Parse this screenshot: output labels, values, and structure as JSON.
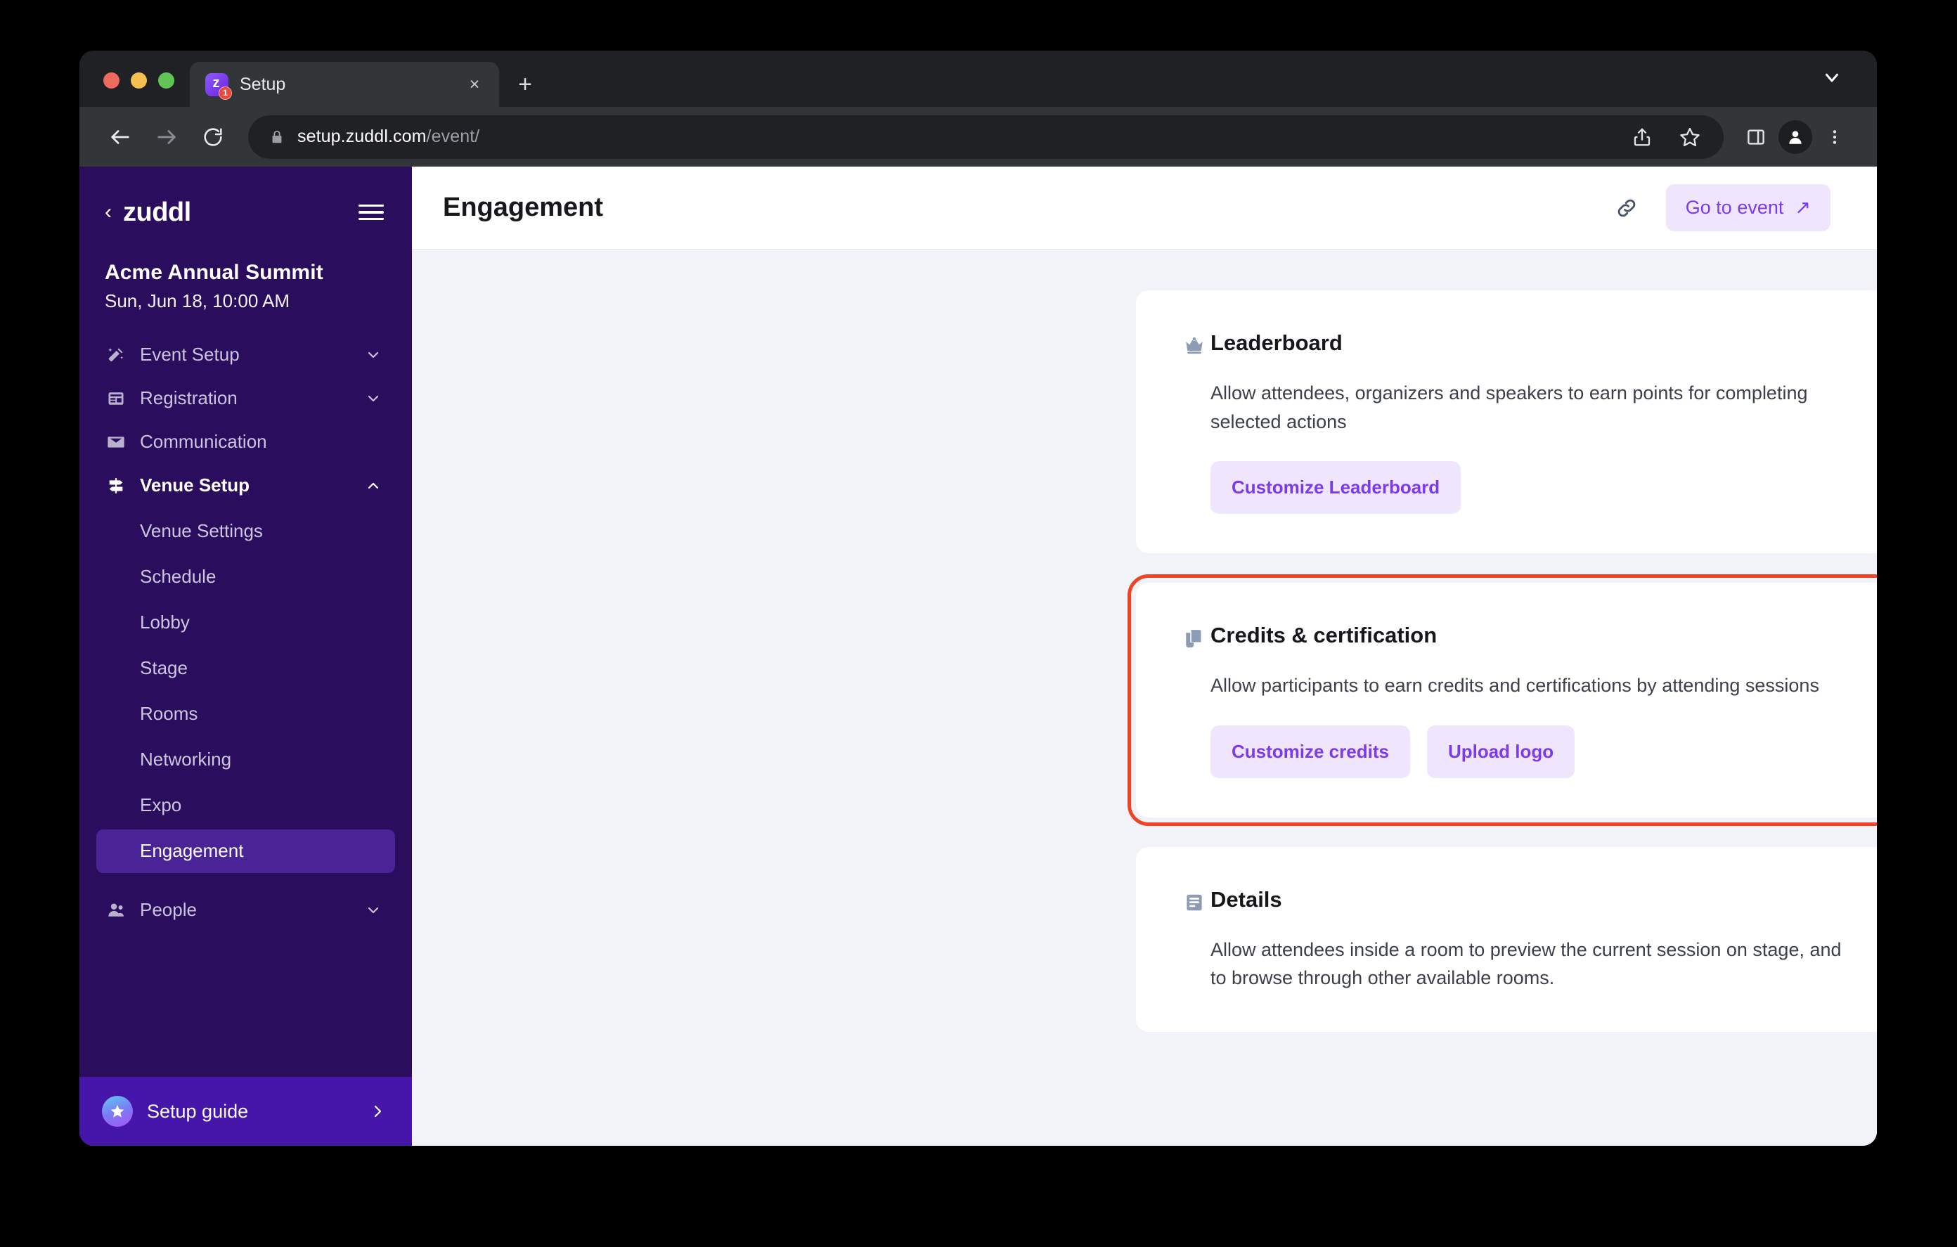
{
  "browser": {
    "tab": {
      "title": "Setup",
      "favicon_glyph": "z",
      "badge_count": "1"
    },
    "new_tab_label": "+",
    "close_label": "×",
    "url_host": "setup.zuddl.com",
    "url_path": "/event/",
    "icons": {
      "back": "back-arrow-icon",
      "forward": "forward-arrow-icon",
      "reload": "reload-icon",
      "lock": "lock-icon",
      "share": "share-icon",
      "bookmark": "star-icon",
      "sidepanel": "side-panel-icon",
      "profile": "profile-avatar-icon",
      "menu": "kebab-menu-icon",
      "tab-list": "chevron-down-icon"
    }
  },
  "sidebar": {
    "back_glyph": "‹",
    "logo": "zuddl",
    "event_name": "Acme Annual Summit",
    "event_date": "Sun, Jun 18, 10:00 AM",
    "nav": [
      {
        "label": "Event Setup",
        "icon": "magic-wand-icon",
        "expanded": false
      },
      {
        "label": "Registration",
        "icon": "form-icon",
        "expanded": false
      },
      {
        "label": "Communication",
        "icon": "envelope-icon",
        "expanded": null
      },
      {
        "label": "Venue Setup",
        "icon": "signpost-icon",
        "expanded": true
      }
    ],
    "venue_children": [
      {
        "label": "Venue Settings",
        "active": false
      },
      {
        "label": "Schedule",
        "active": false
      },
      {
        "label": "Lobby",
        "active": false
      },
      {
        "label": "Stage",
        "active": false
      },
      {
        "label": "Rooms",
        "active": false
      },
      {
        "label": "Networking",
        "active": false
      },
      {
        "label": "Expo",
        "active": false
      },
      {
        "label": "Engagement",
        "active": true
      }
    ],
    "people": {
      "label": "People",
      "icon": "people-icon"
    },
    "setup_guide": {
      "label": "Setup guide",
      "icon": "star-badge-icon",
      "chevron": "›"
    }
  },
  "header": {
    "title": "Engagement",
    "link_icon": "link-icon",
    "goto_event_label": "Go to event",
    "goto_event_arrow": "↗"
  },
  "cards": [
    {
      "id": "leaderboard",
      "icon": "crown-icon",
      "title": "Leaderboard",
      "description": "Allow attendees, organizers and speakers to earn points for completing selected actions",
      "toggle_state": "on",
      "buttons": [
        "Customize Leaderboard"
      ],
      "highlighted": false
    },
    {
      "id": "credits-certification",
      "icon": "certificate-scroll-icon",
      "title": "Credits & certification",
      "description": "Allow participants to earn credits and certifications by attending sessions",
      "toggle_state": "off",
      "buttons": [
        "Customize credits",
        "Upload logo"
      ],
      "highlighted": true
    },
    {
      "id": "details",
      "icon": "article-list-icon",
      "title": "Details",
      "description": "Allow attendees inside a room to preview the current session on stage, and to browse through other available rooms.",
      "toggle_state": "on",
      "buttons": [],
      "highlighted": false
    }
  ],
  "colors": {
    "sidebar_bg": "#2b0d5e",
    "sidebar_active": "#4a2397",
    "setup_guide_bg": "#4616ab",
    "accent_purple": "#7c3aed",
    "accent_purple_soft": "#efe6fd",
    "toggle_on": "#41a952",
    "toggle_off": "#dfe3ed",
    "highlight_outline": "#f04323",
    "page_bg": "#f1f3f8"
  }
}
